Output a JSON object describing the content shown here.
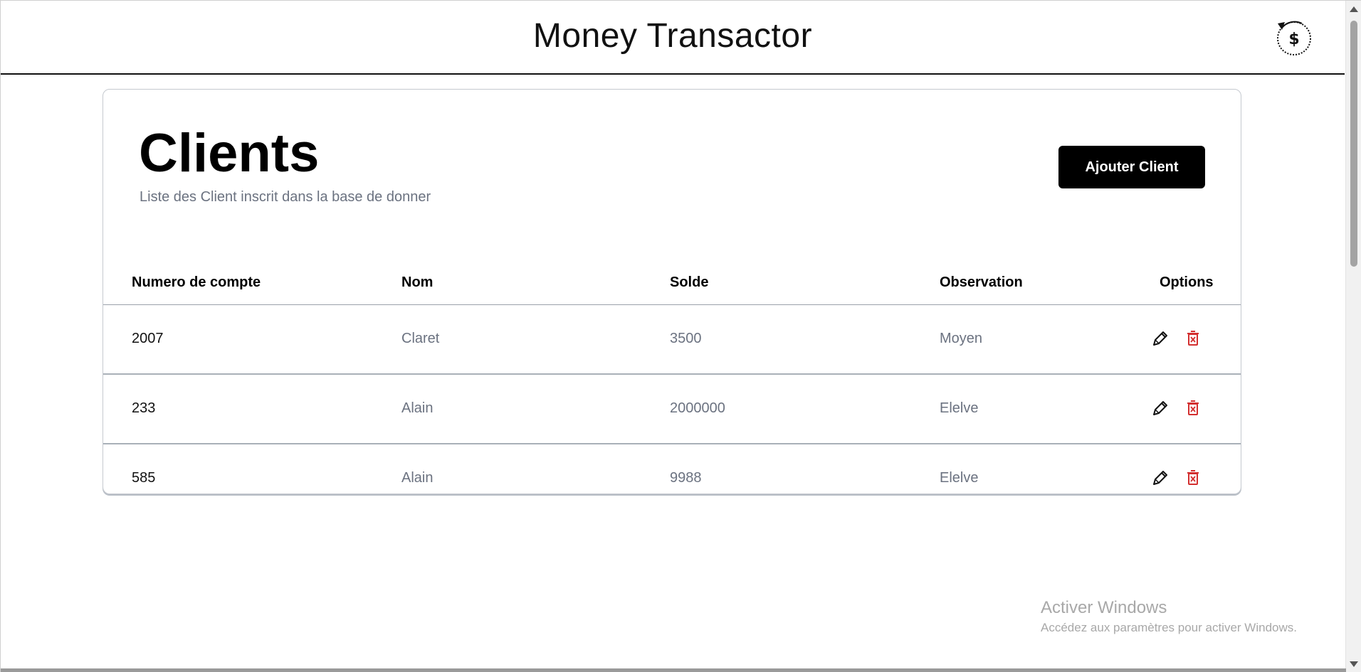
{
  "header": {
    "title": "Money Transactor",
    "history_icon": "dollar-history-icon"
  },
  "card": {
    "title": "Clients",
    "subtitle": "Liste des Client inscrit dans la base de donner",
    "add_button_label": "Ajouter Client"
  },
  "table": {
    "headers": [
      "Numero de compte",
      "Nom",
      "Solde",
      "Observation",
      "Options"
    ],
    "rows": [
      {
        "account": "2007",
        "name": "Claret",
        "balance": "3500",
        "observation": "Moyen"
      },
      {
        "account": "233",
        "name": "Alain",
        "balance": "2000000",
        "observation": "Elelve"
      },
      {
        "account": "585",
        "name": "Alain",
        "balance": "9988",
        "observation": "Elelve"
      }
    ],
    "option_icons": {
      "edit": "pencil-icon",
      "delete": "trash-icon"
    }
  },
  "watermark": {
    "title": "Activer Windows",
    "subtitle": "Accédez aux paramètres pour activer Windows."
  },
  "colors": {
    "accent": "#000000",
    "delete": "#d32f2f",
    "muted_text": "#6b7280"
  }
}
